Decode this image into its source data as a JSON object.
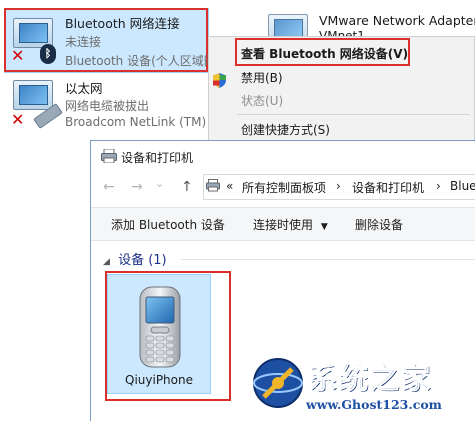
{
  "network": {
    "bluetooth": {
      "name": "Bluetooth 网络连接",
      "status": "未连接",
      "device": "Bluetooth 设备(个人区域网"
    },
    "ethernet": {
      "name": "以太网",
      "status": "网络电缆被拔出",
      "device": "Broadcom NetLink (TM)"
    },
    "vmware": {
      "name": "VMware Network Adapter",
      "sub": "VMnet1"
    }
  },
  "context_menu": {
    "items": [
      {
        "label": "查看 Bluetooth 网络设备(V)",
        "state": "default"
      },
      {
        "label": "禁用(B)",
        "state": "normal"
      },
      {
        "label": "状态(U)",
        "state": "disabled"
      },
      {
        "label": "创建快捷方式(S)",
        "state": "normal"
      }
    ]
  },
  "window": {
    "title": "设备和打印机",
    "nav": {
      "back": "←",
      "forward": "→",
      "dropdown": "⌄",
      "up": "↑"
    },
    "breadcrumb": {
      "prefix": "«",
      "items": [
        "所有控制面板项",
        "设备和打印机",
        "Bluet"
      ],
      "separator": "›"
    },
    "commands": {
      "add_bluetooth": "添加 Bluetooth 设备",
      "connect_using": "连接时使用",
      "remove_device": "删除设备"
    },
    "group": {
      "toggle": "◢",
      "label": "设备 (1)"
    },
    "devices": [
      {
        "name": "QiuyiPhone"
      }
    ]
  },
  "watermark": {
    "title": "系统之家",
    "url": "www.Ghost123.com"
  },
  "colors": {
    "selection": "#cce8ff",
    "highlight_frame": "#d9302c",
    "group_header": "#1e3287"
  }
}
